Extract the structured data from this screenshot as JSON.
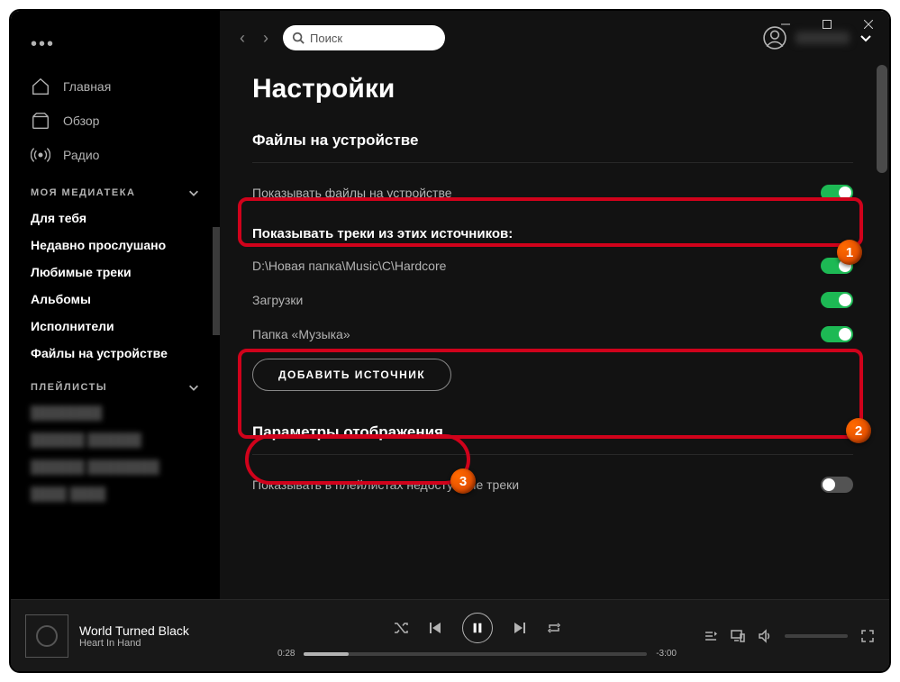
{
  "window": {
    "minimize": "—",
    "maximize": "▢",
    "close": "✕"
  },
  "more": "•••",
  "nav": {
    "home": "Главная",
    "browse": "Обзор",
    "radio": "Радио"
  },
  "library": {
    "header": "МОЯ МЕДИАТЕКА",
    "items": [
      "Для тебя",
      "Недавно прослушано",
      "Любимые треки",
      "Альбомы",
      "Исполнители",
      "Файлы на устройстве"
    ]
  },
  "playlists": {
    "header": "ПЛЕЙЛИСТЫ",
    "new": "Новый плейлист"
  },
  "search": {
    "placeholder": "Поиск"
  },
  "page": {
    "title": "Настройки",
    "section_local": "Файлы на устройстве",
    "show_local": "Показывать файлы на устройстве",
    "sources_label": "Показывать треки из этих источников:",
    "source1": "D:\\Новая папка\\Music\\C\\Hardcore",
    "source2": "Загрузки",
    "source3": "Папка «Музыка»",
    "add_source": "ДОБАВИТЬ ИСТОЧНИК",
    "section_display": "Параметры отображения",
    "show_unavailable": "Показывать в плейлистах недоступные треки"
  },
  "callouts": {
    "c1": "1",
    "c2": "2",
    "c3": "3"
  },
  "player": {
    "track": "World Turned Black",
    "artist": "Heart In Hand",
    "elapsed": "0:28",
    "remaining": "-3:00"
  }
}
